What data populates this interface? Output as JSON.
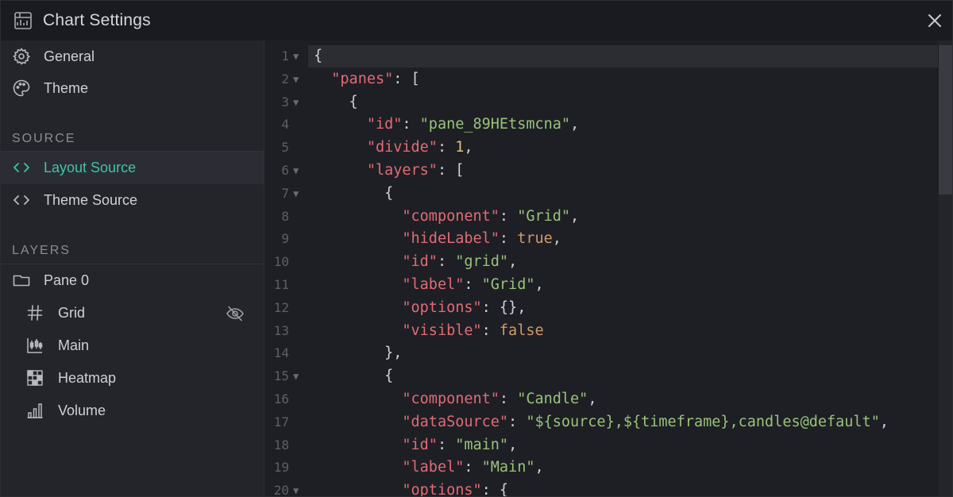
{
  "window": {
    "title": "Chart Settings"
  },
  "sidebar": {
    "top_items": [
      {
        "label": "General",
        "icon": "gear-icon"
      },
      {
        "label": "Theme",
        "icon": "palette-icon"
      }
    ],
    "source_section": {
      "heading": "SOURCE",
      "items": [
        {
          "label": "Layout Source",
          "icon": "code-icon",
          "active": true
        },
        {
          "label": "Theme Source",
          "icon": "code-icon",
          "active": false
        }
      ]
    },
    "layers_section": {
      "heading": "LAYERS",
      "pane": {
        "label": "Pane 0",
        "icon": "folder-icon"
      },
      "layers": [
        {
          "label": "Grid",
          "icon": "hash-icon",
          "hidden": true
        },
        {
          "label": "Main",
          "icon": "candlestick-icon"
        },
        {
          "label": "Heatmap",
          "icon": "heatmap-icon"
        },
        {
          "label": "Volume",
          "icon": "bar-chart-icon"
        }
      ]
    }
  },
  "editor": {
    "lines": [
      {
        "n": "1",
        "fold": true,
        "text": "{"
      },
      {
        "n": "2",
        "fold": true,
        "text": "  \"panes\": ["
      },
      {
        "n": "3",
        "fold": true,
        "text": "    {"
      },
      {
        "n": "4",
        "fold": false,
        "text": "      \"id\": \"pane_89HEtsmcna\","
      },
      {
        "n": "5",
        "fold": false,
        "text": "      \"divide\": 1,"
      },
      {
        "n": "6",
        "fold": true,
        "text": "      \"layers\": ["
      },
      {
        "n": "7",
        "fold": true,
        "text": "        {"
      },
      {
        "n": "8",
        "fold": false,
        "text": "          \"component\": \"Grid\","
      },
      {
        "n": "9",
        "fold": false,
        "text": "          \"hideLabel\": true,"
      },
      {
        "n": "10",
        "fold": false,
        "text": "          \"id\": \"grid\","
      },
      {
        "n": "11",
        "fold": false,
        "text": "          \"label\": \"Grid\","
      },
      {
        "n": "12",
        "fold": false,
        "text": "          \"options\": {},"
      },
      {
        "n": "13",
        "fold": false,
        "text": "          \"visible\": false"
      },
      {
        "n": "14",
        "fold": false,
        "text": "        },"
      },
      {
        "n": "15",
        "fold": true,
        "text": "        {"
      },
      {
        "n": "16",
        "fold": false,
        "text": "          \"component\": \"Candle\","
      },
      {
        "n": "17",
        "fold": false,
        "text": "          \"dataSource\": \"${source},${timeframe},candles@default\","
      },
      {
        "n": "18",
        "fold": false,
        "text": "          \"id\": \"main\","
      },
      {
        "n": "19",
        "fold": false,
        "text": "          \"label\": \"Main\","
      },
      {
        "n": "20",
        "fold": true,
        "text": "          \"options\": {"
      }
    ]
  },
  "colors": {
    "accent": "#3fc3a7",
    "key": "#e06c75",
    "string": "#98c379",
    "number": "#e5c07b",
    "boolean": "#d19a66"
  }
}
